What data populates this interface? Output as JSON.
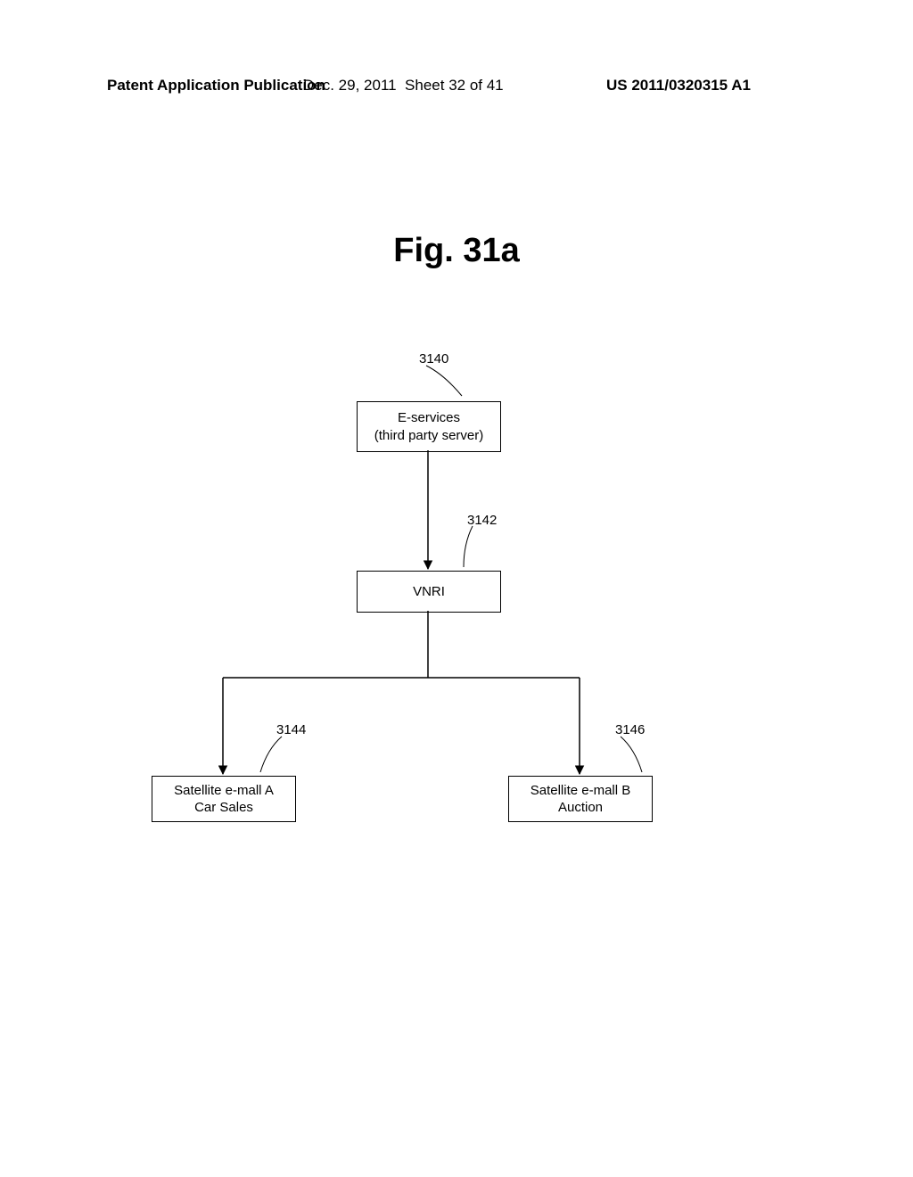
{
  "header": {
    "left": "Patent Application Publication",
    "mid_date": "Dec. 29, 2011",
    "mid_sheet": "Sheet 32 of 41",
    "right": "US 2011/0320315 A1"
  },
  "figure_title": "Fig. 31a",
  "boxes": {
    "eservices": {
      "line1": "E-services",
      "line2": "(third party server)",
      "ref": "3140"
    },
    "vnri": {
      "line1": "VNRI",
      "ref": "3142"
    },
    "mall_a": {
      "line1": "Satellite e-mall A",
      "line2": "Car Sales",
      "ref": "3144"
    },
    "mall_b": {
      "line1": "Satellite e-mall B",
      "line2": "Auction",
      "ref": "3146"
    }
  }
}
